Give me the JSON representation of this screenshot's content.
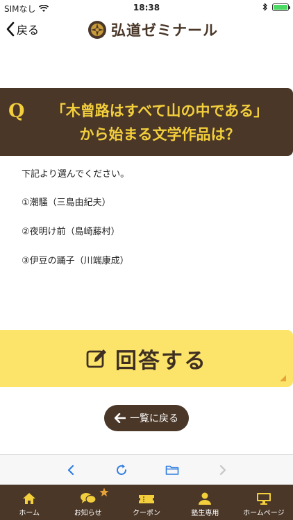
{
  "status": {
    "carrier": "SIMなし",
    "time": "18:38"
  },
  "nav": {
    "back_label": "戻る",
    "logo_text": "弘道ゼミナール"
  },
  "question": {
    "mark": "Q",
    "line1": "「木曾路はすべて山の中である」",
    "line2": "から始まる文学作品は？"
  },
  "content": {
    "intro": "下記より選んでください。",
    "options": [
      "①潮騒（三島由紀夫）",
      "②夜明け前（島崎藤村）",
      "③伊豆の踊子（川端康成）"
    ]
  },
  "answer_button": {
    "label": "回答する"
  },
  "list_button": {
    "label": "一覧に戻る"
  },
  "tabs": [
    {
      "label": "ホーム",
      "icon": "home-icon"
    },
    {
      "label": "お知らせ",
      "icon": "chat-icon"
    },
    {
      "label": "クーポン",
      "icon": "ticket-icon"
    },
    {
      "label": "塾生専用",
      "icon": "person-icon"
    },
    {
      "label": "ホームページ",
      "icon": "monitor-icon"
    }
  ],
  "colors": {
    "brown": "#4a3728",
    "gold_text": "#f3cf3c",
    "answer_yellow": "#fce46a",
    "browser_blue": "#2f7de1",
    "badge_orange": "#e8a23a"
  }
}
